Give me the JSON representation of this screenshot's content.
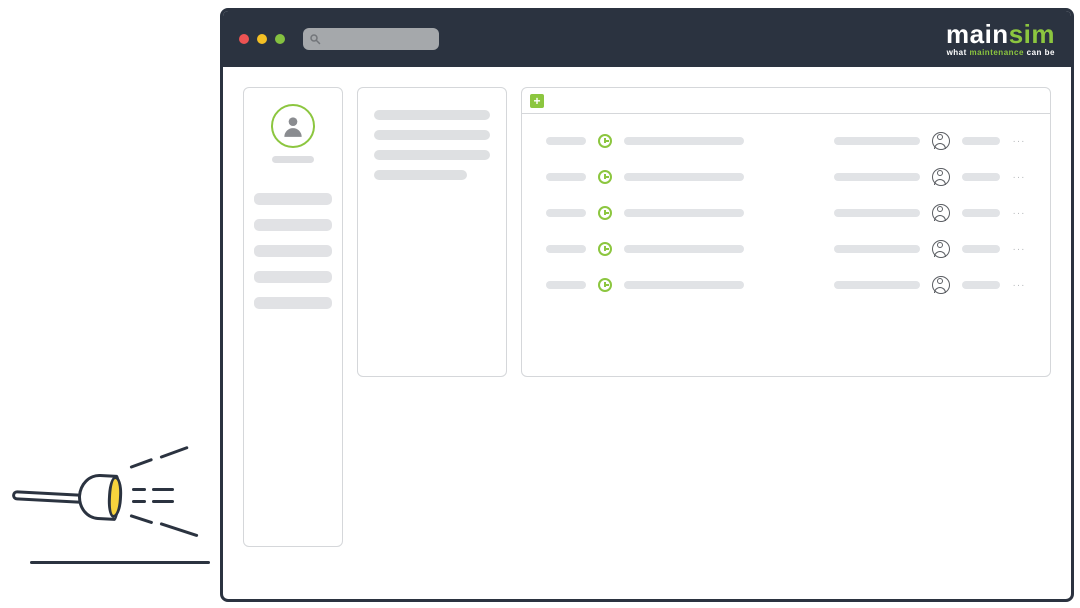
{
  "brand": {
    "name_main": "main",
    "name_accent": "sim",
    "tagline_pre": "what ",
    "tagline_accent": "maintenance",
    "tagline_post": " can be"
  },
  "titlebar": {
    "search_placeholder": "",
    "traffic_lights": [
      "close",
      "minimize",
      "zoom"
    ]
  },
  "sidebar": {
    "avatar": "user-avatar",
    "nav_items": [
      "",
      "",
      "",
      "",
      ""
    ]
  },
  "midcolumn": {
    "lines": [
      "",
      "",
      "",
      ""
    ]
  },
  "mainpanel": {
    "add_label": "+",
    "rows": [
      {
        "id": 1
      },
      {
        "id": 2
      },
      {
        "id": 3
      },
      {
        "id": 4
      },
      {
        "id": 5
      }
    ],
    "kebab": "···"
  },
  "icons": {
    "search": "search-icon",
    "clock": "clock-icon",
    "person": "person-icon",
    "add": "add-icon",
    "flashlight": "flashlight-icon"
  }
}
